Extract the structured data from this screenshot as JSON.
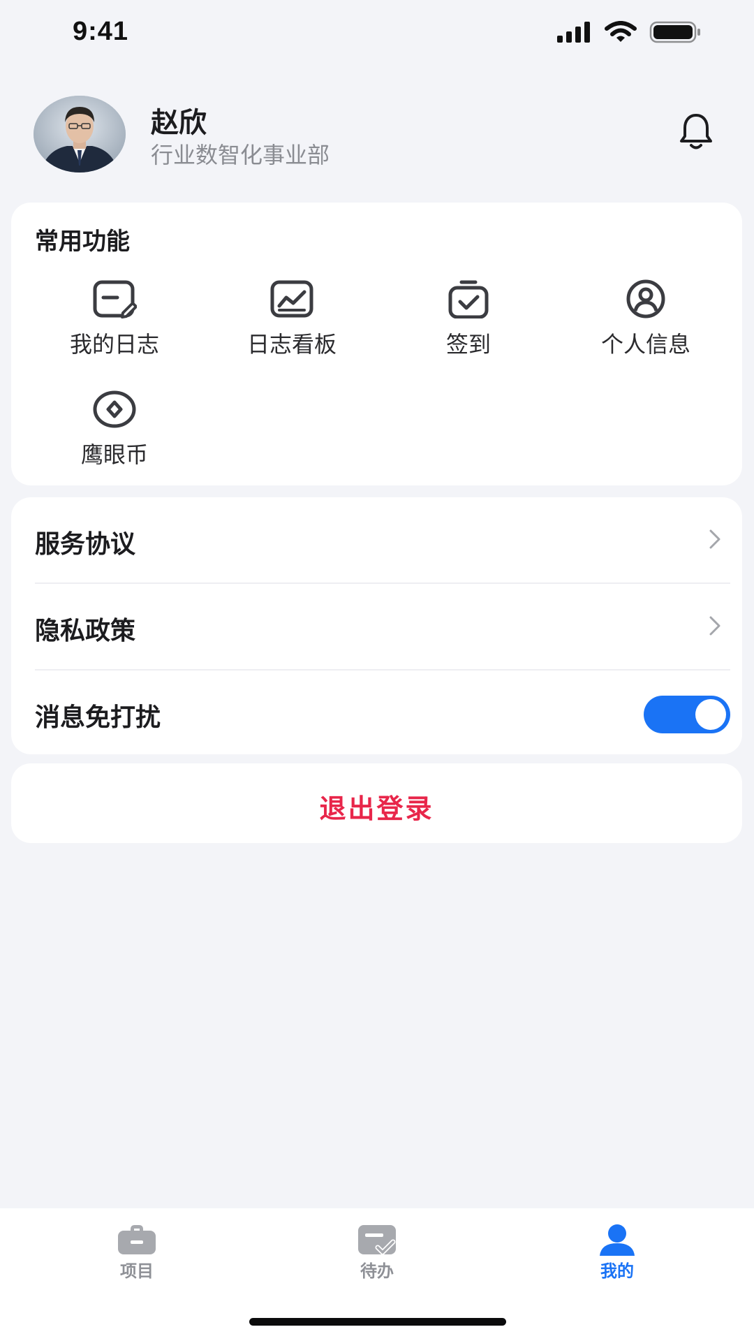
{
  "status_bar": {
    "time": "9:41",
    "icons": [
      "cellular-signal-icon",
      "wifi-icon",
      "battery-icon"
    ]
  },
  "profile": {
    "name": "赵欣",
    "department": "行业数智化事业部",
    "avatar_icon": "user-photo",
    "notification_icon": "bell-icon"
  },
  "common_functions": {
    "title": "常用功能",
    "items": [
      {
        "label": "我的日志",
        "icon": "log-edit-icon"
      },
      {
        "label": "日志看板",
        "icon": "chart-board-icon"
      },
      {
        "label": "签到",
        "icon": "check-in-icon"
      },
      {
        "label": "个人信息",
        "icon": "user-circle-icon"
      },
      {
        "label": "鹰眼币",
        "icon": "coin-icon"
      }
    ]
  },
  "settings": {
    "service_agreement": "服务协议",
    "privacy_policy": "隐私政策",
    "do_not_disturb": "消息免打扰",
    "do_not_disturb_on": true
  },
  "logout": {
    "label": "退出登录"
  },
  "tabbar": {
    "tabs": [
      {
        "label": "项目",
        "icon": "briefcase-icon",
        "active": false
      },
      {
        "label": "待办",
        "icon": "todo-check-icon",
        "active": false
      },
      {
        "label": "我的",
        "icon": "person-icon",
        "active": true
      }
    ]
  },
  "colors": {
    "background": "#f3f4f8",
    "accent": "#1a73f5",
    "danger": "#e8264a",
    "inactive_tab": "#8e9096",
    "icon_stroke": "#3b3c41"
  }
}
